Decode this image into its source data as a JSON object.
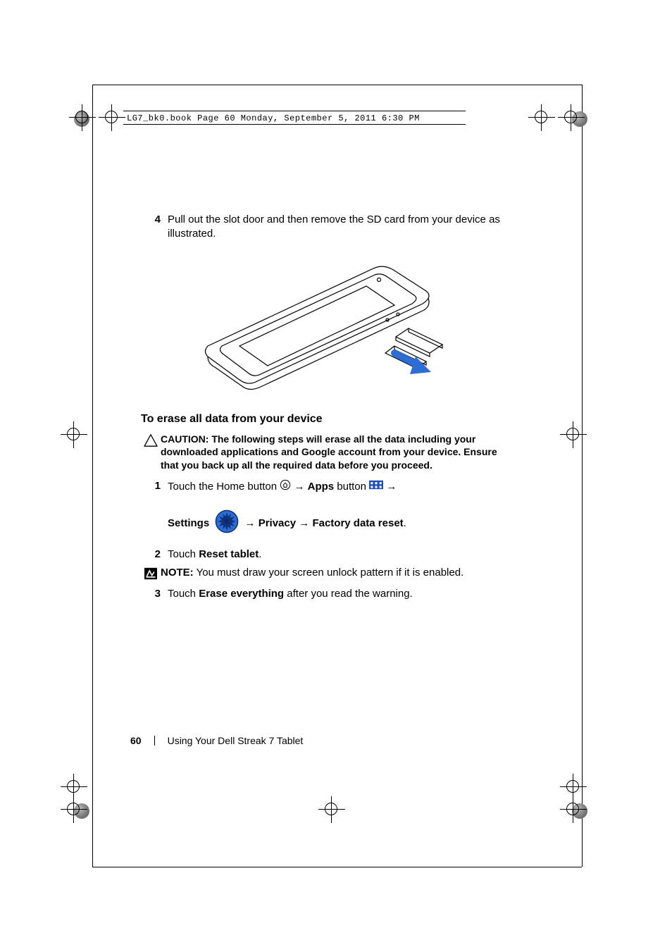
{
  "header": {
    "stamp": "LG7_bk0.book  Page 60  Monday, September 5, 2011  6:30 PM"
  },
  "section_top": {
    "step_num": "4",
    "step_text": "Pull out the slot door and then remove the SD card from your device as illustrated."
  },
  "section_heading": "To erase all data from your device",
  "caution": {
    "label": "CAUTION:",
    "text": "The following steps will erase all the data including your downloaded applications and Google account from your device. Ensure that you back up all the required data before you proceed."
  },
  "erase_steps": {
    "s1": {
      "num": "1",
      "part_a": "Touch the Home button ",
      "arrow1": "→",
      "apps_label": "Apps",
      "button_word": " button ",
      "arrow2": "→",
      "settings_label": "Settings",
      "arrow3": "→",
      "privacy_label": "Privacy",
      "arrow4": "→",
      "factory_label": "Factory data reset",
      "period": "."
    },
    "s2": {
      "num": "2",
      "pre": "Touch ",
      "bold": "Reset tablet",
      "post": "."
    },
    "note": {
      "label": "NOTE:",
      "text": "You must draw your screen unlock pattern if it is enabled."
    },
    "s3": {
      "num": "3",
      "pre": "Touch ",
      "bold": "Erase everything",
      "post": " after you read the warning."
    }
  },
  "footer": {
    "page_number": "60",
    "chapter_title": "Using Your Dell Streak 7 Tablet"
  }
}
